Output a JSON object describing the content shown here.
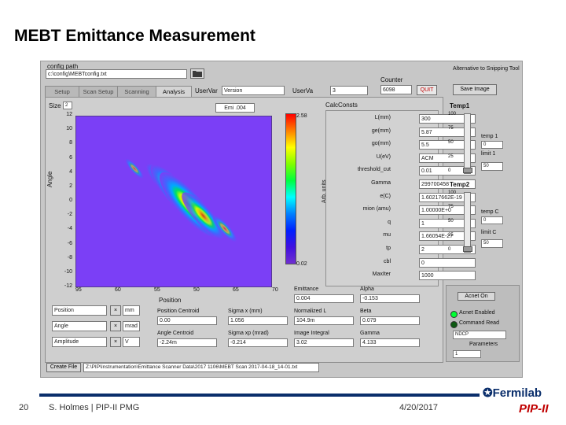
{
  "slide": {
    "title": "MEBT Emittance Measurement",
    "page_number": "20",
    "author": "S. Holmes | PIP-II PMG",
    "date": "4/20/2017",
    "logo_fermilab": "Fermilab",
    "logo_pip": "PIP-II"
  },
  "app": {
    "config_path_label": "config path",
    "config_path_value": "c:\\config\\MEBTconfig.txt",
    "tabs": [
      "Setup",
      "Scan Setup",
      "Scanning",
      "Analysis"
    ],
    "user_var_label": "UserVar",
    "user_var_value": "Version",
    "user_va2_label": "UserVa",
    "user_va2_value": "3",
    "counter_label": "Counter",
    "counter_value": "6098",
    "quit_label": "QUIT",
    "alternative_label": "Alternative to Snipping Tool",
    "save_image_label": "Save Image",
    "size_label": "Size",
    "size_value": "2",
    "emittance_top_value": "Emi .004",
    "colorbar_max": "2.58",
    "colorbar_min": "0.02",
    "colorbar_axis_label": "Arb. units",
    "x_axis_label": "Position",
    "y_axis_label": "Angle",
    "x_ticks": [
      "95",
      "60",
      "55",
      "50",
      "65",
      "70"
    ],
    "y_ticks": [
      "12",
      "10",
      "8",
      "6",
      "4",
      "2",
      "0",
      "-2",
      "-4",
      "-6",
      "-8",
      "-10",
      "-12"
    ],
    "calc_consts_label": "CalcConsts",
    "params": [
      {
        "label": "L(mm)",
        "value": "300"
      },
      {
        "label": "ge(mm)",
        "value": "5.87"
      },
      {
        "label": "go(mm)",
        "value": "5.5"
      },
      {
        "label": "U(eV)",
        "value": "ACM"
      },
      {
        "label": "threshold_cut",
        "value": "0.01"
      },
      {
        "label": "Gamma",
        "value": "299700458"
      },
      {
        "label": "e(C)",
        "value": "1.60217662E-19"
      },
      {
        "label": "mion (amu)",
        "value": "1.00000E+0"
      },
      {
        "label": "q",
        "value": "1"
      },
      {
        "label": "mu",
        "value": "1.66054E-27"
      },
      {
        "label": "tp",
        "value": "2"
      },
      {
        "label": "cbl",
        "value": "0"
      },
      {
        "label": "MaxIter",
        "value": "1000"
      }
    ],
    "temp1": {
      "label": "Temp1",
      "ticks": [
        "100",
        "75",
        "50",
        "25",
        "0"
      ],
      "t_label": "temp 1",
      "t_value": "0",
      "limit_label": "limit 1",
      "limit_value": "50"
    },
    "temp2": {
      "label": "Temp2",
      "ticks": [
        "100",
        "75",
        "50",
        "25",
        "0"
      ],
      "t_label": "temp C",
      "t_value": "0",
      "limit_label": "limit C",
      "limit_value": "50"
    },
    "selectors": [
      {
        "value": "Position",
        "units": "mm"
      },
      {
        "value": "Angle",
        "units": "mrad"
      },
      {
        "value": "Amplitude",
        "units": "V"
      }
    ],
    "results": [
      {
        "label": "Position Centroid",
        "value": "0.00"
      },
      {
        "label": "Sigma x (mm)",
        "value": "1.056"
      },
      {
        "label": "Normalized L",
        "value": "104.9m"
      },
      {
        "label": "Beta",
        "value": "0.079"
      },
      {
        "label": "Angle Centroid",
        "value": "-2.24m"
      },
      {
        "label": "Sigma xp (mrad)",
        "value": "-0.214"
      },
      {
        "label": "Image Integral",
        "value": "3.02"
      },
      {
        "label": "Gamma",
        "value": "4.133"
      },
      {
        "label": "Emittance",
        "value": "0.004"
      },
      {
        "label": "Alpha",
        "value": "-0.153"
      }
    ],
    "acnet_on_label": "Acnet On",
    "acnet_enabled_label": "Acnet Enabled",
    "command_read_label": "Command Read",
    "device_value": "NDCP",
    "parameters_label": "Parameters",
    "param_value": "1",
    "create_file_label": "Create File",
    "file_path_value": "Z:\\PIP\\Instrumentation\\Emittance Scanner Data\\2017 1106\\MEBT Scan 2017-04-18_14-01.txt",
    "colors": {
      "background": "#c7c7c7",
      "heatmap_background": "#7b3ff6",
      "acnet_led_on": "#00ff33",
      "acnet_led_off": "#0d5a12",
      "quit_red": "#c00000"
    }
  },
  "chart_data": {
    "type": "heatmap",
    "xlabel": "Position",
    "ylabel": "Angle",
    "xticks": [
      "95",
      "60",
      "55",
      "50",
      "65",
      "70"
    ],
    "yticks": [
      12,
      10,
      8,
      6,
      4,
      2,
      0,
      -2,
      -4,
      -6,
      -8,
      -10,
      -12
    ],
    "ylim": [
      -12,
      12
    ],
    "colorbar_range": [
      0.02,
      2.58
    ],
    "colorbar_label": "Arb. units",
    "series": [
      {
        "x": 0.3,
        "y": 4.6,
        "value": 0.3
      },
      {
        "x": 0.45,
        "y": 2.6,
        "value": 1.2
      },
      {
        "x": 0.52,
        "y": 1.0,
        "value": 2.2
      },
      {
        "x": 0.58,
        "y": -0.5,
        "value": 2.5
      },
      {
        "x": 0.65,
        "y": -2.0,
        "value": 1.6
      },
      {
        "x": 0.76,
        "y": -3.8,
        "value": 0.6
      }
    ]
  }
}
